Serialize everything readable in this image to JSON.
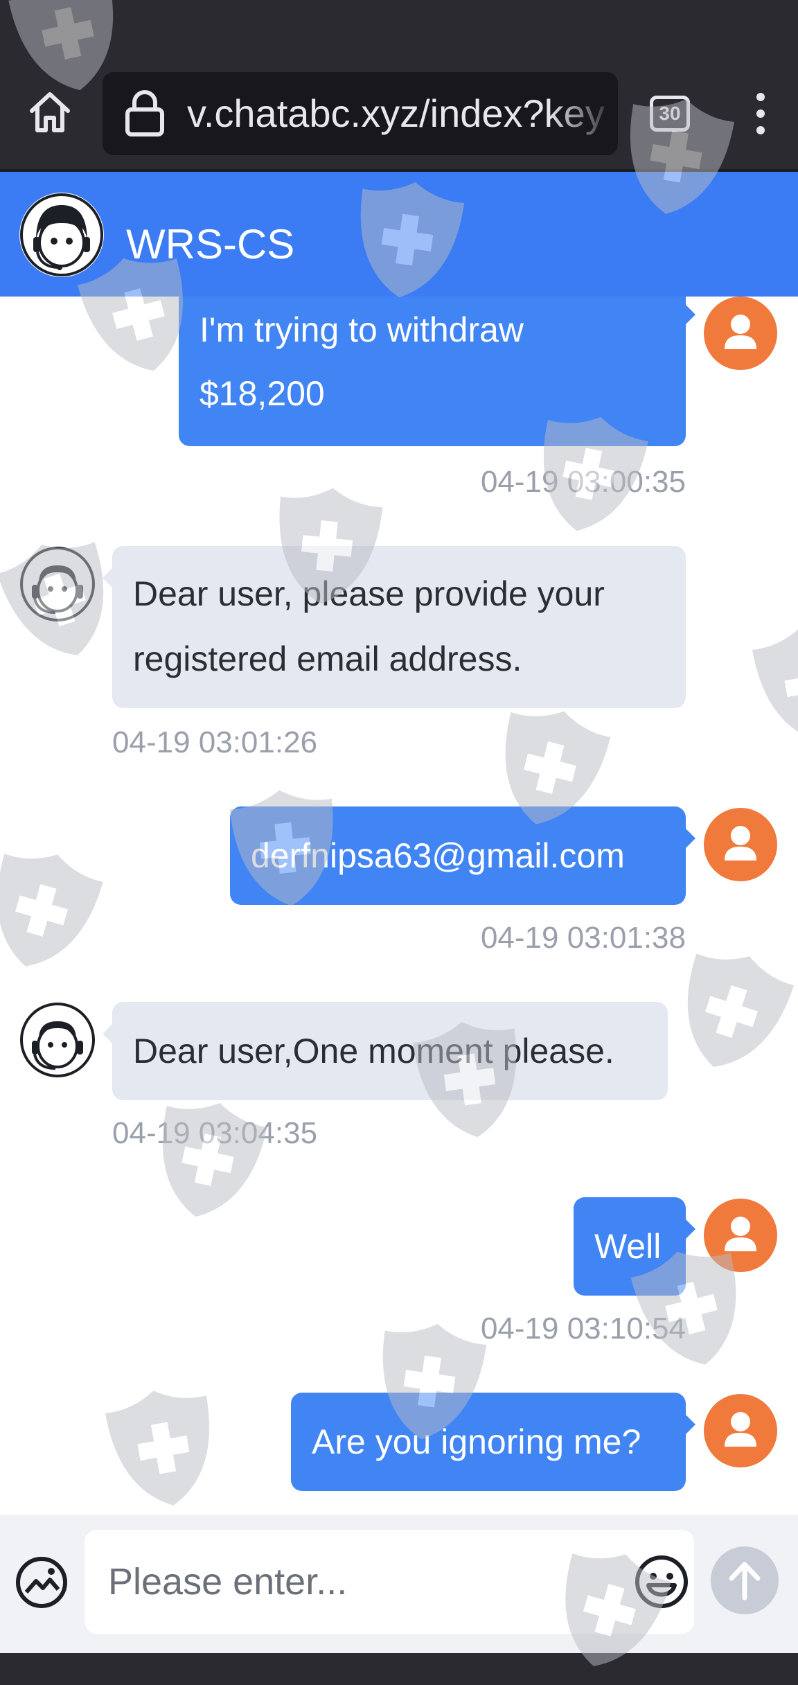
{
  "browser": {
    "url": "v.chatabc.xyz/index?key",
    "tab_count": "30",
    "icons": {
      "home": "home-icon",
      "lock": "lock-icon",
      "menu": "more-vert-icon"
    }
  },
  "header": {
    "title": "WRS-CS",
    "background_color": "#3b7cf4"
  },
  "messages": [
    {
      "sender": "user",
      "lines": [
        "I'm trying to withdraw",
        "$18,200"
      ],
      "timestamp": "04-19 03:00:35"
    },
    {
      "sender": "agent",
      "lines": [
        "Dear user, please provide your",
        "registered email address."
      ],
      "timestamp": "04-19 03:01:26"
    },
    {
      "sender": "user",
      "lines": [
        "derfnipsa63@gmail.com"
      ],
      "timestamp": "04-19 03:01:38"
    },
    {
      "sender": "agent",
      "lines": [
        "Dear user,One moment please."
      ],
      "timestamp": "04-19 03:04:35"
    },
    {
      "sender": "user",
      "lines": [
        "Well"
      ],
      "timestamp": "04-19 03:10:54"
    },
    {
      "sender": "user",
      "lines": [
        "Are you ignoring me?"
      ],
      "timestamp": ""
    }
  ],
  "input": {
    "placeholder": "Please enter...",
    "icons": {
      "image": "image-icon",
      "emoji": "emoji-icon",
      "send": "send-arrow-icon"
    }
  },
  "colors": {
    "user_bubble": "#4185f5",
    "agent_bubble": "#e4e8f0",
    "user_avatar": "#f07a3c",
    "timestamp": "#9aa0ab"
  }
}
